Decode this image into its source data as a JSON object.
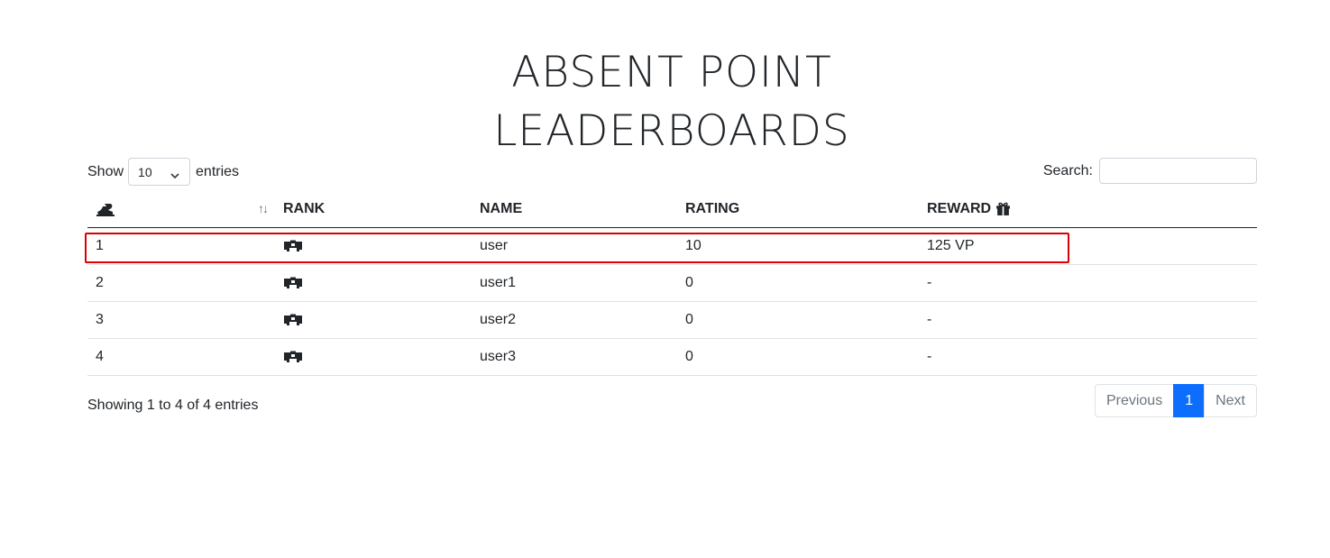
{
  "title": {
    "line1": "ABSENT POINT",
    "line2": "LEADERBOARDS"
  },
  "length_control": {
    "prefix": "Show",
    "selected": "10",
    "suffix": "entries"
  },
  "search": {
    "label": "Search:",
    "value": ""
  },
  "table": {
    "headers": {
      "position_icon": "ranking-icon",
      "sort_indicator": "↑↓",
      "rank": "RANK",
      "name": "NAME",
      "rating": "RATING",
      "reward": "REWARD",
      "reward_icon": "gift-icon"
    },
    "rows": [
      {
        "position": "1",
        "rank_icon": "rank-badge-icon",
        "name": "user",
        "rating": "10",
        "reward": "125 VP"
      },
      {
        "position": "2",
        "rank_icon": "rank-badge-icon",
        "name": "user1",
        "rating": "0",
        "reward": "-"
      },
      {
        "position": "3",
        "rank_icon": "rank-badge-icon",
        "name": "user2",
        "rating": "0",
        "reward": "-"
      },
      {
        "position": "4",
        "rank_icon": "rank-badge-icon",
        "name": "user3",
        "rating": "0",
        "reward": "-"
      }
    ]
  },
  "info": "Showing 1 to 4 of 4 entries",
  "pagination": {
    "previous": "Previous",
    "current": "1",
    "next": "Next"
  },
  "colors": {
    "highlight_border": "#dc0000",
    "active_page": "#0d6efd"
  }
}
